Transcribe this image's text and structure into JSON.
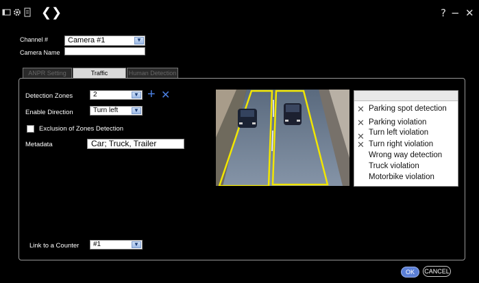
{
  "window": {
    "help": "?",
    "minimize": "−",
    "close": "✕"
  },
  "toolbar": {
    "back": "❮",
    "forward": "❯"
  },
  "channel": {
    "label": "Channel #",
    "value": "Camera #1"
  },
  "camera_name": {
    "label": "Camera Name",
    "value": ""
  },
  "tabs": [
    {
      "label": "ANPR Setting",
      "active": false
    },
    {
      "label": "Traffic Management",
      "active": true
    },
    {
      "label": "Human Detection",
      "active": false
    }
  ],
  "settings": {
    "detection_zones_label": "Detection Zones",
    "detection_zones_value": "2",
    "add_symbol": "+",
    "remove_symbol": "✕",
    "enable_direction_label": "Enable Direction",
    "enable_direction_value": "Turn left",
    "exclusion_label": "Exclusion of Zones Detection",
    "metadata_label": "Metadata",
    "metadata_value": "Car; Truck, Trailer",
    "counter_label": "Link to a Counter",
    "counter_value": "#1"
  },
  "violations": [
    {
      "label": "Parking spot detection",
      "checked": true
    },
    {
      "label": "Parking violation",
      "checked": true
    },
    {
      "label": "Turn left violation",
      "checked": true
    },
    {
      "label": "Turn right violation",
      "checked": true
    },
    {
      "label": "Wrong way detection",
      "checked": false
    },
    {
      "label": "Truck violation",
      "checked": false
    },
    {
      "label": "Motorbike violation",
      "checked": false
    }
  ],
  "buttons": {
    "ok": "OK",
    "cancel": "CANCEL"
  },
  "colors": {
    "zone_outline": "#f2e600",
    "ok_button": "#5b7fd6",
    "add_remove": "#4a7fe0"
  }
}
